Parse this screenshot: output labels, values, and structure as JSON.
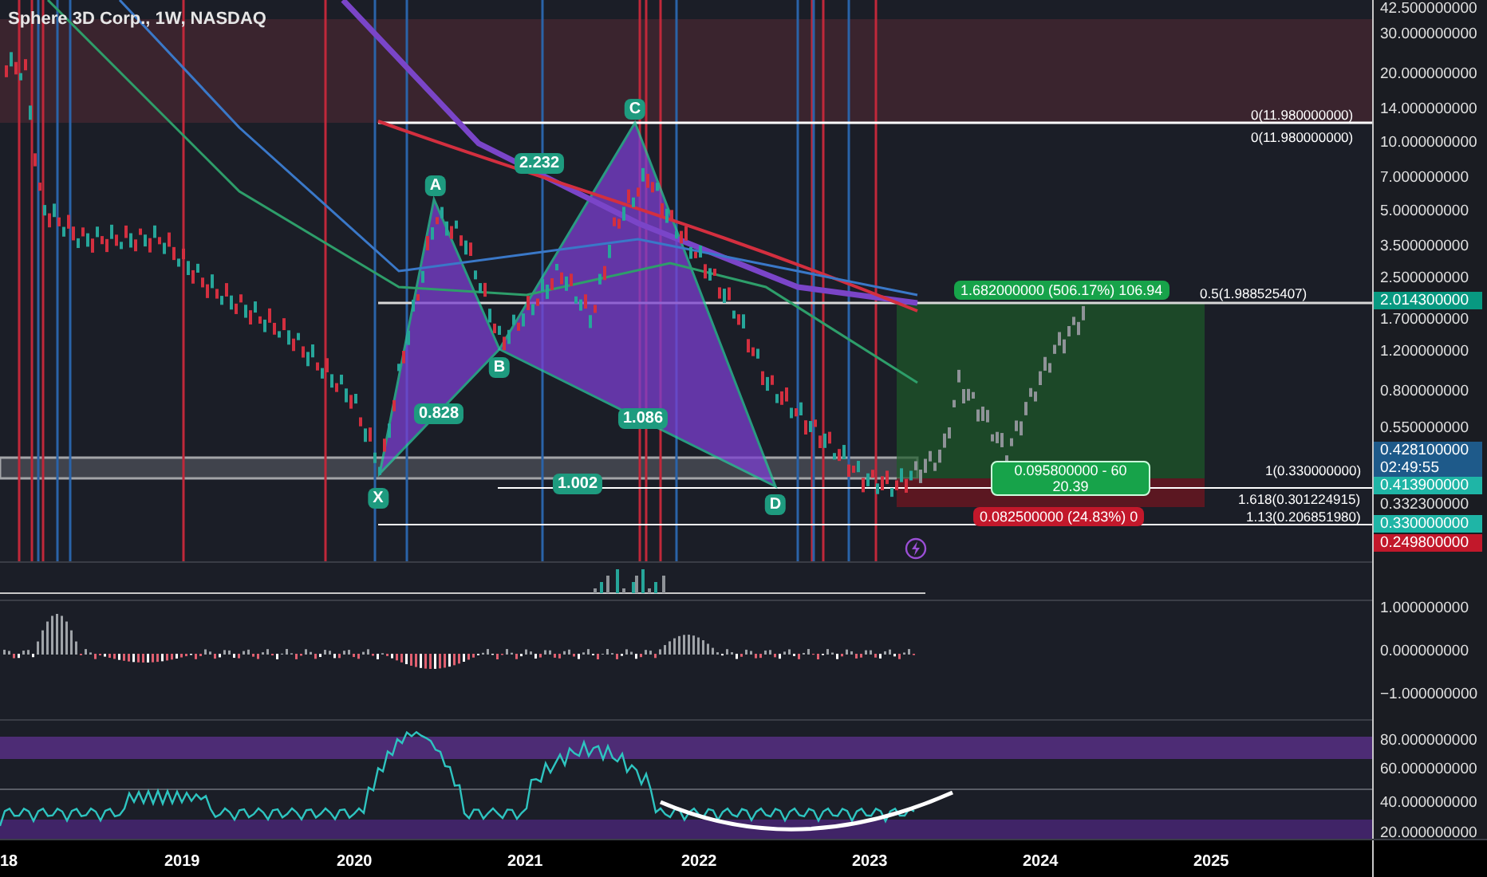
{
  "chart_title": "Sphere 3D Corp., 1W, NASDAQ",
  "pattern_points": [
    {
      "label": "A"
    },
    {
      "label": "C"
    },
    {
      "label": "B"
    },
    {
      "label": "X"
    },
    {
      "label": "D"
    }
  ],
  "pattern_ratios": [
    "2.232",
    "0.828",
    "1.086",
    "1.002"
  ],
  "fib_labels": [
    "0(11.980000000)",
    "0(11.980000000)",
    "0.5(1.988525407)",
    "1(0.330000000)",
    "1.618(0.301224915)",
    "1.13(0.206851980)"
  ],
  "position": {
    "target": "1.682000000 (506.17%) 106.94",
    "entry": "0.095800000 - 60",
    "entry_count": "20.39",
    "stop": "0.082500000 (24.83%) 0"
  },
  "price_axis": [
    {
      "kind": "tick",
      "text": "42.500000000"
    },
    {
      "kind": "tick",
      "text": "30.000000000"
    },
    {
      "kind": "tick",
      "text": "20.000000000"
    },
    {
      "kind": "tick",
      "text": "14.000000000"
    },
    {
      "kind": "tick",
      "text": "10.000000000"
    },
    {
      "kind": "tick",
      "text": "7.000000000"
    },
    {
      "kind": "tick",
      "text": "5.000000000"
    },
    {
      "kind": "tick",
      "text": "3.500000000"
    },
    {
      "kind": "tick",
      "text": "2.500000000"
    },
    {
      "kind": "badge",
      "text": "2.014300000",
      "color": "#089981"
    },
    {
      "kind": "tick",
      "text": "1.700000000"
    },
    {
      "kind": "tick",
      "text": "1.200000000"
    },
    {
      "kind": "tick",
      "text": "0.800000000"
    },
    {
      "kind": "tick",
      "text": "0.550000000"
    },
    {
      "kind": "badge",
      "text": "0.428100000",
      "sub": "02:49:55",
      "color": "#1e5a8a"
    },
    {
      "kind": "badge",
      "text": "0.413900000",
      "color": "#1fb5a6"
    },
    {
      "kind": "tick",
      "text": "0.332300000"
    },
    {
      "kind": "badge",
      "text": "0.330000000",
      "color": "#1fb5a6"
    },
    {
      "kind": "badge",
      "text": "0.249800000",
      "color": "#c2182b"
    }
  ],
  "macd_axis": [
    "1.000000000",
    "0.000000000",
    "−1.000000000"
  ],
  "rsi_axis": [
    "80.000000000",
    "60.000000000",
    "40.000000000",
    "20.000000000"
  ],
  "time_axis": [
    "18",
    "2019",
    "2020",
    "2021",
    "2022",
    "2023",
    "2024",
    "2025"
  ]
}
